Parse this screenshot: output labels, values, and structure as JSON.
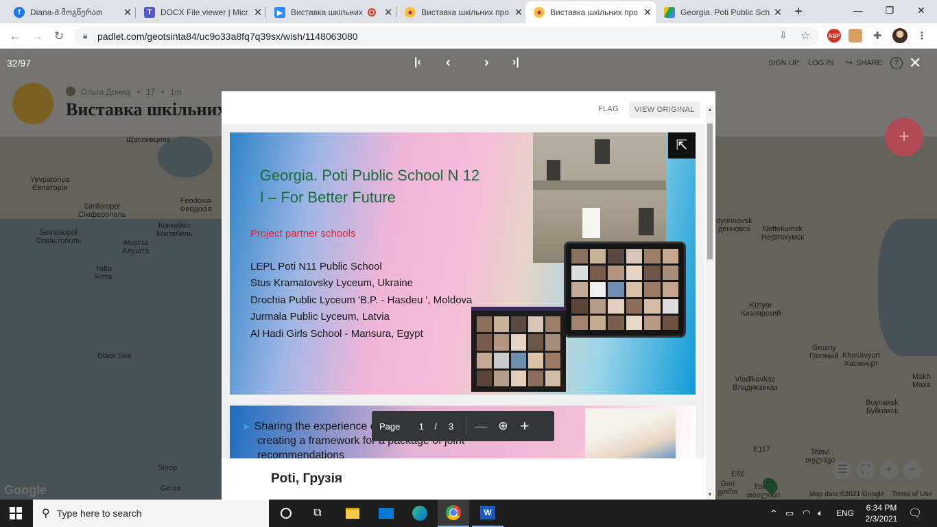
{
  "tabs": [
    {
      "title": "Diana-ð მოგწერათ",
      "icon": "facebook-icon",
      "color": "#1877f2"
    },
    {
      "title": "DOCX File viewer | Micr",
      "icon": "teams-icon",
      "color": "#5059c9"
    },
    {
      "title": "Виставка шкільних",
      "icon": "zoom-icon",
      "color": "#2d8cff"
    },
    {
      "title": "Виставка шкільних про",
      "icon": "padlet-icon",
      "color": "#e6318d"
    },
    {
      "title": "Виставка шкільних про",
      "icon": "padlet-icon",
      "color": "#e6318d"
    },
    {
      "title": "Georgia. Poti Public Sch",
      "icon": "google-drive-icon",
      "color": "#1fa463"
    }
  ],
  "url": "padlet.com/geotsinta84/uc9o33a8fq7q39sx/wish/1148063080",
  "viewer": {
    "counter": "32/97",
    "flag": "FLAG",
    "view_original": "VIEW ORIGINAL",
    "signup": "SIGN UP",
    "login": "LOG IN",
    "share": "SHARE"
  },
  "padlet": {
    "author": "Ольга Донец",
    "meta_dot": "•",
    "votes": "17",
    "age": "1m",
    "title": "Виставка шкільних"
  },
  "slide1": {
    "title_line1": "Georgia. Poti Public School N 12",
    "title_line2": "I – For Better Future",
    "partners_heading": "Project partner schools",
    "schools": [
      "LEPL Poti N11 Public School",
      "Stus Kramatovsky Lyceum, Ukraine",
      "Drochia Public Lyceum 'B.P. - Hasdeu ', Moldova",
      "Jurmala Public Lyceum, Latvia",
      "Al Hadi Girls School - Mansura, Egypt"
    ]
  },
  "slide2": {
    "line1": "Sharing the experience of different countries and",
    "line2": "creating a framework for a package of joint",
    "line3": "recommendations"
  },
  "pdf_toolbar": {
    "page_label": "Page",
    "current_page": "1",
    "separator": "/",
    "total_pages": "3"
  },
  "caption": "Poti, Грузія",
  "map": {
    "labels": [
      {
        "text": "Щасливцеве"
      },
      {
        "text": "Yevpatoriya\nЄвпаторія"
      },
      {
        "text": "Feodosia\nФеодосія"
      },
      {
        "text": "Simferopol\nСімферополь"
      },
      {
        "text": "Коктебел\nКоктебель"
      },
      {
        "text": "Sevastopol\nСевастополь"
      },
      {
        "text": "Alushta\nАлушта"
      },
      {
        "text": "Yalta\nЯлта"
      },
      {
        "text": "Black Sea"
      },
      {
        "text": "Sinop"
      },
      {
        "text": "Gerze"
      },
      {
        "text": "dyonnovsk\nденновск"
      },
      {
        "text": "Neftekumsk\nНефтекумск"
      },
      {
        "text": "Kizlyar\nКизлярский"
      },
      {
        "text": "Grozny\nГрозный"
      },
      {
        "text": "Khasavyurt\nХасавюрт"
      },
      {
        "text": "Vladikavkaz\nВладикавказ"
      },
      {
        "text": "Makh\nМаха"
      },
      {
        "text": "Buynaksk\nБуйнакск"
      },
      {
        "text": "Telavi\nთელავი"
      },
      {
        "text": "Gori\nგორი"
      },
      {
        "text": "Tbilisi\nთბილისი"
      },
      {
        "text": "E117"
      },
      {
        "text": "E60"
      }
    ],
    "attribution": "Map data ©2021 Google",
    "terms": "Terms of Use",
    "google": "Google"
  },
  "taskbar": {
    "search_placeholder": "Type here to search",
    "lang": "ENG",
    "time": "6:34 PM",
    "date": "2/3/2021"
  }
}
